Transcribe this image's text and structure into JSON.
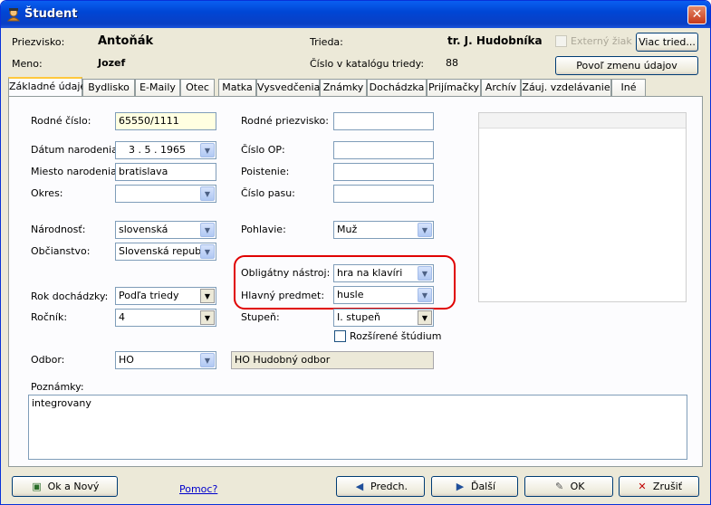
{
  "window": {
    "title": "Študent",
    "close_glyph": "✕"
  },
  "header": {
    "surname_label": "Priezvisko:",
    "surname_value": "Antoňák",
    "name_label": "Meno:",
    "name_value": "Jozef",
    "class_label": "Trieda:",
    "class_value": "tr. J. Hudobníka",
    "catalog_label": "Číslo v katalógu triedy:",
    "catalog_value": "88",
    "external_label": "Externý žiak",
    "more_classes_button": "Viac tried...",
    "allow_edit_button": "Povoľ zmenu údajov"
  },
  "tabs": [
    {
      "label": "Základné údaje"
    },
    {
      "label": "Bydlisko"
    },
    {
      "label": "E-Maily"
    },
    {
      "label": "Otec"
    },
    {
      "label": "Matka"
    },
    {
      "label": "Vysvedčenia"
    },
    {
      "label": "Známky"
    },
    {
      "label": "Dochádzka"
    },
    {
      "label": "Prijímačky"
    },
    {
      "label": "Archív"
    },
    {
      "label": "Záuj. vzdelávanie"
    },
    {
      "label": "Iné"
    }
  ],
  "form": {
    "birth_number_label": "Rodné číslo:",
    "birth_number_value": "65550/1111",
    "birth_date_label": "Dátum narodenia:",
    "birth_date_value": "3 .  5 . 1965",
    "birth_place_label": "Miesto narodenia:",
    "birth_place_value": "bratislava",
    "district_label": "Okres:",
    "district_value": "",
    "nationality_label": "Národnosť:",
    "nationality_value": "slovenská",
    "citizenship_label": "Občianstvo:",
    "citizenship_value": "Slovenská republ",
    "attendance_year_label": "Rok dochádzky:",
    "attendance_year_value": "Podľa triedy",
    "grade_label": "Ročník:",
    "grade_value": "4",
    "department_label": "Odbor:",
    "department_value": "HO",
    "department_desc": "HO Hudobný odbor",
    "birth_surname_label": "Rodné priezvisko:",
    "birth_surname_value": "",
    "id_card_label": "Číslo OP:",
    "id_card_value": "",
    "insurance_label": "Poistenie:",
    "insurance_value": "",
    "passport_label": "Číslo pasu:",
    "passport_value": "",
    "gender_label": "Pohlavie:",
    "gender_value": "Muž",
    "instrument_label": "Obligátny nástroj:",
    "instrument_value": "hra na klavíri",
    "main_subject_label": "Hlavný predmet:",
    "main_subject_value": "husle",
    "level_label": "Stupeň:",
    "level_value": "I. stupeň",
    "extended_study_label": "Rozšírené štúdium",
    "notes_label": "Poznámky:",
    "notes_value": "integrovany"
  },
  "footer": {
    "ok_new_button": "Ok a Nový",
    "help_link": "Pomoc?",
    "prev_button": "Predch.",
    "next_button": "Ďalší",
    "ok_button": "OK",
    "cancel_button": "Zrušiť"
  },
  "colors": {
    "highlight": "#e00000",
    "title_bar": "#0054e3",
    "active_tab": "#ffc83c",
    "yellow_field": "#ffffe1"
  }
}
